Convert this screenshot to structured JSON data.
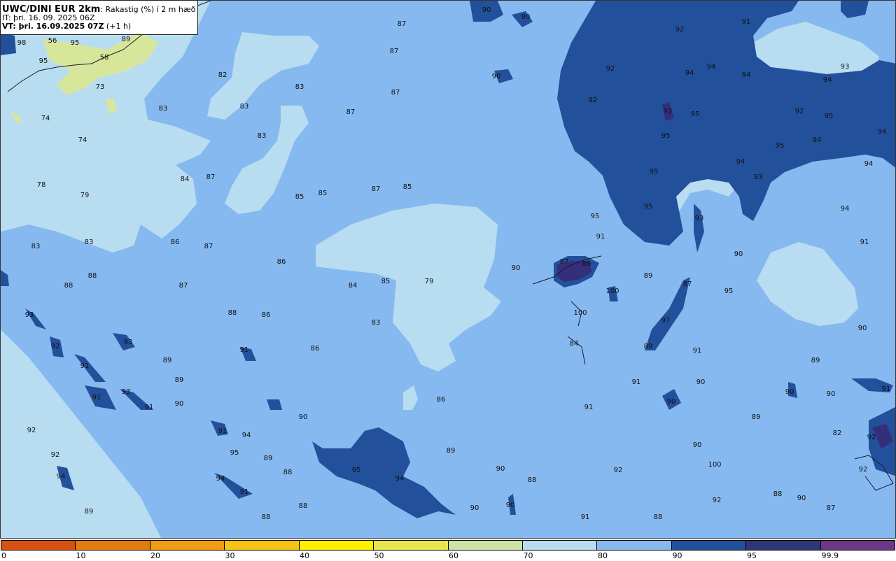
{
  "header": {
    "model": "UWC/DINI EUR 2km",
    "parameter": ": Rakastig (%) í 2 m hæð",
    "issue_time": "IT: þri. 16. 09. 2025 06Z",
    "valid_label": "VT: þri. 16.09.2025 07Z",
    "valid_offset": " (+1 h)"
  },
  "colors": {
    "band_lt70": "#b8ddf1",
    "band_70_80": "#b8ddf1",
    "band_80_90": "#86b9f0",
    "band_90_95": "#23509a",
    "band_95_99": "#352f7a",
    "band_99_100": "#5a3880",
    "band_50_60": "#d8e69c",
    "coast": "#1a1a2e"
  },
  "legend": {
    "colors": [
      "#d65010",
      "#e07c10",
      "#f09b14",
      "#f5c314",
      "#fff000",
      "#e6e650",
      "#cde3a5",
      "#b8ddf1",
      "#86b9f0",
      "#23509a",
      "#2e3578",
      "#6b3786"
    ],
    "ticks": [
      "0",
      "10",
      "20",
      "30",
      "40",
      "50",
      "60",
      "70",
      "80",
      "90",
      "95",
      "99.9"
    ]
  },
  "values": [
    {
      "v": "56"
    },
    {
      "v": "95"
    },
    {
      "v": "89"
    },
    {
      "v": "98"
    },
    {
      "v": "95"
    },
    {
      "v": "58"
    },
    {
      "v": "73"
    },
    {
      "v": "74"
    },
    {
      "v": "74"
    },
    {
      "v": "78"
    },
    {
      "v": "79"
    },
    {
      "v": "83"
    },
    {
      "v": "83"
    },
    {
      "v": "82"
    },
    {
      "v": "83"
    },
    {
      "v": "83"
    },
    {
      "v": "83"
    },
    {
      "v": "84"
    },
    {
      "v": "87"
    },
    {
      "v": "83"
    },
    {
      "v": "86"
    },
    {
      "v": "87"
    },
    {
      "v": "86"
    },
    {
      "v": "88"
    },
    {
      "v": "88"
    },
    {
      "v": "87"
    },
    {
      "v": "85"
    },
    {
      "v": "85"
    },
    {
      "v": "87"
    },
    {
      "v": "85"
    },
    {
      "v": "87"
    },
    {
      "v": "87"
    },
    {
      "v": "87"
    },
    {
      "v": "87"
    },
    {
      "v": "84"
    },
    {
      "v": "85"
    },
    {
      "v": "79"
    },
    {
      "v": "83"
    },
    {
      "v": "86"
    },
    {
      "v": "88"
    },
    {
      "v": "86"
    },
    {
      "v": "89"
    },
    {
      "v": "89"
    },
    {
      "v": "90"
    },
    {
      "v": "91"
    },
    {
      "v": "93"
    },
    {
      "v": "90"
    },
    {
      "v": "86"
    },
    {
      "v": "89"
    },
    {
      "v": "89"
    },
    {
      "v": "88"
    },
    {
      "v": "88"
    },
    {
      "v": "88"
    },
    {
      "v": "90"
    },
    {
      "v": "90"
    },
    {
      "v": "90"
    },
    {
      "v": "90"
    },
    {
      "v": "92"
    },
    {
      "v": "94"
    },
    {
      "v": "94"
    },
    {
      "v": "91"
    },
    {
      "v": "92"
    },
    {
      "v": "92"
    },
    {
      "v": "94"
    },
    {
      "v": "93"
    },
    {
      "v": "92"
    },
    {
      "v": "93"
    },
    {
      "v": "91"
    },
    {
      "v": "91"
    },
    {
      "v": "93"
    },
    {
      "v": "91"
    },
    {
      "v": "92"
    },
    {
      "v": "91"
    },
    {
      "v": "94"
    },
    {
      "v": "95"
    },
    {
      "v": "94"
    },
    {
      "v": "91"
    },
    {
      "v": "92"
    },
    {
      "v": "94"
    },
    {
      "v": "95"
    },
    {
      "v": "94"
    },
    {
      "v": "94"
    },
    {
      "v": "92"
    },
    {
      "v": "92"
    },
    {
      "v": "95"
    },
    {
      "v": "95"
    },
    {
      "v": "95"
    },
    {
      "v": "95"
    },
    {
      "v": "94"
    },
    {
      "v": "94"
    },
    {
      "v": "95"
    },
    {
      "v": "95"
    },
    {
      "v": "94"
    },
    {
      "v": "94"
    },
    {
      "v": "93"
    },
    {
      "v": "93"
    },
    {
      "v": "94"
    },
    {
      "v": "95"
    },
    {
      "v": "91"
    },
    {
      "v": "90"
    },
    {
      "v": "91"
    },
    {
      "v": "89"
    },
    {
      "v": "87"
    },
    {
      "v": "87"
    },
    {
      "v": "89"
    },
    {
      "v": "90"
    },
    {
      "v": "100"
    },
    {
      "v": "100"
    },
    {
      "v": "84"
    },
    {
      "v": "91"
    },
    {
      "v": "95"
    },
    {
      "v": "97"
    },
    {
      "v": "89"
    },
    {
      "v": "91"
    },
    {
      "v": "90"
    },
    {
      "v": "90"
    },
    {
      "v": "91"
    },
    {
      "v": "89"
    },
    {
      "v": "90"
    },
    {
      "v": "90"
    },
    {
      "v": "91"
    },
    {
      "v": "90"
    },
    {
      "v": "82"
    },
    {
      "v": "92"
    },
    {
      "v": "92"
    },
    {
      "v": "89"
    },
    {
      "v": "90"
    },
    {
      "v": "100"
    },
    {
      "v": "92"
    },
    {
      "v": "88"
    },
    {
      "v": "90"
    },
    {
      "v": "90"
    },
    {
      "v": "89"
    },
    {
      "v": "91"
    },
    {
      "v": "92"
    },
    {
      "v": "88"
    },
    {
      "v": "90"
    },
    {
      "v": "87"
    },
    {
      "v": "88"
    },
    {
      "v": "84"
    },
    {
      "v": "84"
    },
    {
      "v": "85"
    },
    {
      "v": "90"
    },
    {
      "v": "87"
    }
  ]
}
